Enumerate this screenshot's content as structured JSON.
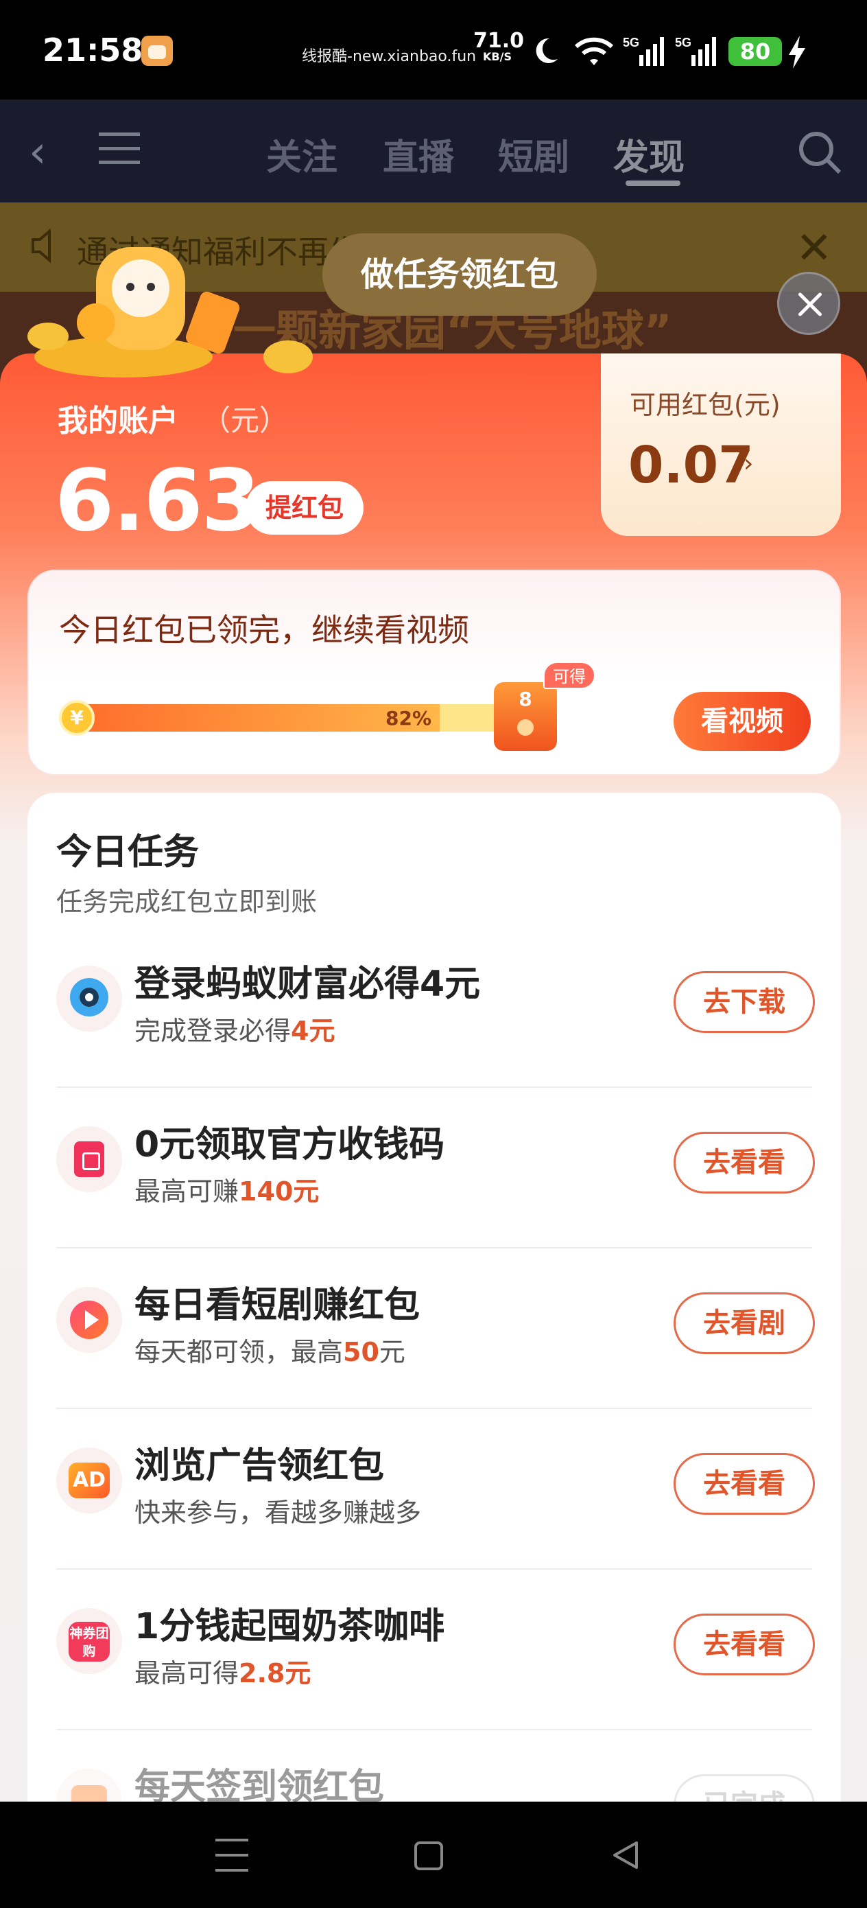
{
  "status_bar": {
    "time": "21:58",
    "site": "线报酷-new.xianbao.fun",
    "speed_value": "71.0",
    "speed_unit": "KB/S",
    "signal_1": "5G",
    "signal_2": "5G",
    "battery": "80",
    "icons": [
      "app-badge-icon",
      "moon-icon",
      "wifi-icon",
      "signal-icon",
      "signal-icon",
      "battery-icon",
      "charging-bolt-icon"
    ]
  },
  "background_app": {
    "tabs": [
      "关注",
      "直播",
      "短剧",
      "发现"
    ],
    "active_tab": "发现",
    "notice_text": "通过通知福利不再发放",
    "banner_text": "一颗新家园“大号地球”",
    "icons": [
      "back-icon",
      "menu-icon",
      "search-icon",
      "speaker-icon",
      "close-icon"
    ]
  },
  "popup": {
    "title": "做任务领红包",
    "account": {
      "label": "我的账户",
      "unit": "（元）",
      "value": "6.63",
      "withdraw_label": "提红包"
    },
    "coupon": {
      "label": "可用红包(元)",
      "value": "0.07",
      "arrow": "›"
    },
    "video_card": {
      "heading": "今日红包已领完，继续看视频",
      "progress": 0.82,
      "progress_label": "82%",
      "coin_symbol": "¥",
      "reward_count": "8",
      "reward_tag": "可得",
      "button_label": "看视频"
    },
    "tasks": {
      "title": "今日任务",
      "subtitle": "任务完成红包立即到账",
      "items": [
        {
          "icon": "ant-fortune-icon",
          "name": "登录蚂蚁财富必得4元",
          "desc_prefix": "完成登录必得",
          "desc_highlight": "4元",
          "desc_suffix": "",
          "button": "去下载"
        },
        {
          "icon": "payment-code-icon",
          "name": "0元领取官方收钱码",
          "desc_prefix": "最高可赚",
          "desc_highlight": "140元",
          "desc_suffix": "",
          "button": "去看看"
        },
        {
          "icon": "short-drama-play-icon",
          "name": "每日看短剧赚红包",
          "desc_prefix": "每天都可领，最高",
          "desc_highlight": "50",
          "desc_suffix": "元",
          "button": "去看剧"
        },
        {
          "icon": "ad-icon",
          "name": "浏览广告领红包",
          "desc_prefix": "快来参与，看越多赚越多",
          "desc_highlight": "",
          "desc_suffix": "",
          "button": "去看看"
        },
        {
          "icon": "shenquan-group-buy-icon",
          "name": "1分钱起囤奶茶咖啡",
          "desc_prefix": "最高可得",
          "desc_highlight": "2.8元",
          "desc_suffix": "",
          "button": "去看看"
        },
        {
          "icon": "calendar-checkin-icon",
          "name": "每天签到领红包",
          "desc_prefix": "",
          "desc_highlight": "",
          "desc_suffix": "",
          "button": "已完成"
        }
      ],
      "ad_icon_text": "AD",
      "shen_icon_text": "神券团购"
    },
    "close_icon": "close-icon"
  },
  "nav_bar": {
    "icons": [
      "nav-menu-icon",
      "nav-home-icon",
      "nav-back-icon"
    ]
  },
  "colors": {
    "accent_red": "#f0401e",
    "highlight_orange": "#e0552a",
    "coupon_brown": "#8a3b12",
    "battery_green": "#3fbf3a"
  }
}
